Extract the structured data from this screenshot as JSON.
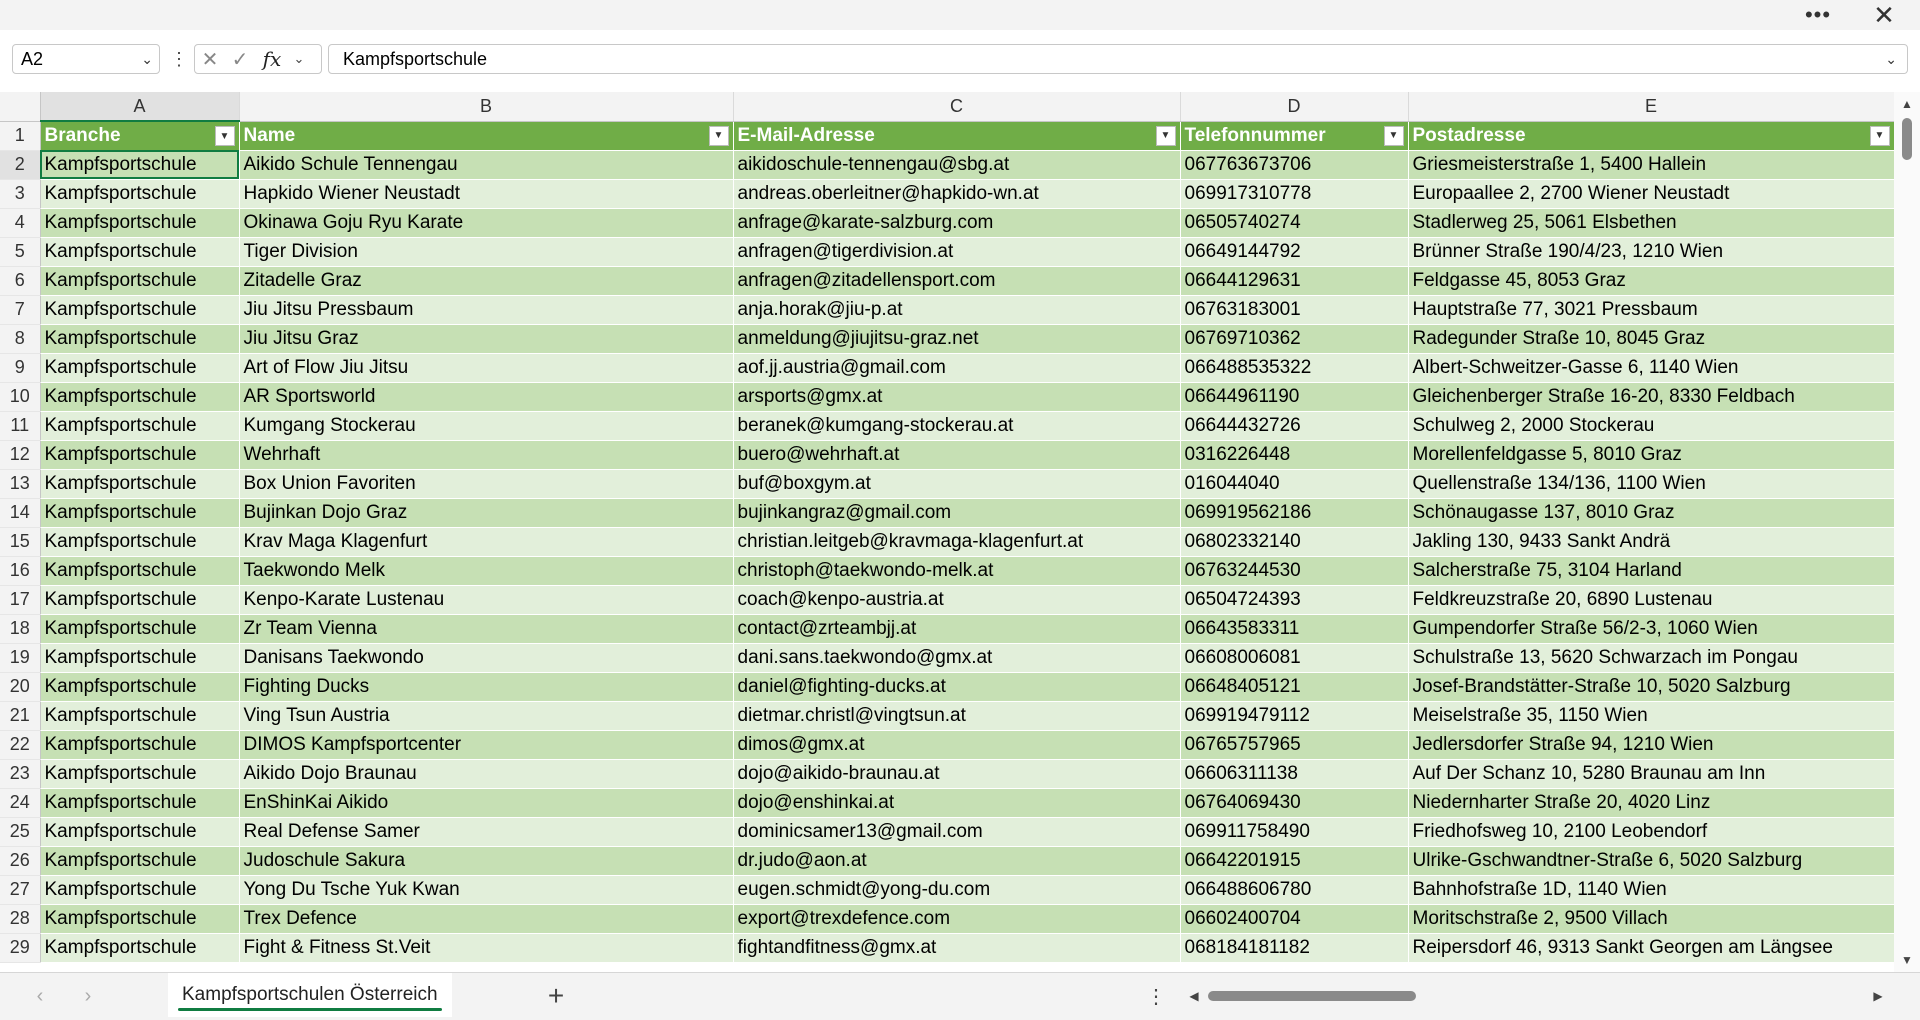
{
  "window": {
    "more_icon": "more-horizontal-icon",
    "close_icon": "close-icon"
  },
  "formula_bar": {
    "name_box": "A2",
    "formula": "Kampfsportschule",
    "fx_label": "fx"
  },
  "grid": {
    "columns": [
      "A",
      "B",
      "C",
      "D",
      "E"
    ],
    "selected_column": "A",
    "selected_row": 2,
    "header_row_number": 1,
    "headers": [
      "Branche",
      "Name",
      "E-Mail-Adresse",
      "Telefonnummer",
      "Postadresse"
    ],
    "rows": [
      {
        "n": 2,
        "cells": [
          "Kampfsportschule",
          "Aikido Schule Tennengau",
          "aikidoschule-tennengau@sbg.at",
          "067763673706",
          "Griesmeisterstraße 1, 5400 Hallein"
        ]
      },
      {
        "n": 3,
        "cells": [
          "Kampfsportschule",
          "Hapkido Wiener Neustadt",
          "andreas.oberleitner@hapkido-wn.at",
          "069917310778",
          "Europaallee 2, 2700 Wiener Neustadt"
        ]
      },
      {
        "n": 4,
        "cells": [
          "Kampfsportschule",
          "Okinawa Goju Ryu Karate",
          "anfrage@karate-salzburg.com",
          "06505740274",
          "Stadlerweg 25, 5061 Elsbethen"
        ]
      },
      {
        "n": 5,
        "cells": [
          "Kampfsportschule",
          "Tiger Division",
          "anfragen@tigerdivision.at",
          "06649144792",
          "Brünner Straße 190/4/23, 1210 Wien"
        ]
      },
      {
        "n": 6,
        "cells": [
          "Kampfsportschule",
          "Zitadelle Graz",
          "anfragen@zitadellensport.com",
          "06644129631",
          "Feldgasse 45, 8053 Graz"
        ]
      },
      {
        "n": 7,
        "cells": [
          "Kampfsportschule",
          "Jiu Jitsu Pressbaum",
          "anja.horak@jiu-p.at",
          "06763183001",
          "Hauptstraße 77, 3021 Pressbaum"
        ]
      },
      {
        "n": 8,
        "cells": [
          "Kampfsportschule",
          "Jiu Jitsu Graz",
          "anmeldung@jiujitsu-graz.net",
          "06769710362",
          "Radegunder Straße 10, 8045 Graz"
        ]
      },
      {
        "n": 9,
        "cells": [
          "Kampfsportschule",
          "Art of Flow Jiu Jitsu",
          "aof.jj.austria@gmail.com",
          "066488535322",
          "Albert-Schweitzer-Gasse 6, 1140 Wien"
        ]
      },
      {
        "n": 10,
        "cells": [
          "Kampfsportschule",
          "AR Sportsworld",
          "arsports@gmx.at",
          "06644961190",
          "Gleichenberger Straße 16-20, 8330 Feldbach"
        ]
      },
      {
        "n": 11,
        "cells": [
          "Kampfsportschule",
          "Kumgang Stockerau",
          "beranek@kumgang-stockerau.at",
          "06644432726",
          "Schulweg 2, 2000 Stockerau"
        ]
      },
      {
        "n": 12,
        "cells": [
          "Kampfsportschule",
          "Wehrhaft",
          "buero@wehrhaft.at",
          "0316226448",
          "Morellenfeldgasse 5, 8010 Graz"
        ]
      },
      {
        "n": 13,
        "cells": [
          "Kampfsportschule",
          "Box Union Favoriten",
          "buf@boxgym.at",
          "016044040",
          "Quellenstraße 134/136, 1100 Wien"
        ]
      },
      {
        "n": 14,
        "cells": [
          "Kampfsportschule",
          "Bujinkan Dojo Graz",
          "bujinkangraz@gmail.com",
          "069919562186",
          "Schönaugasse 137, 8010 Graz"
        ]
      },
      {
        "n": 15,
        "cells": [
          "Kampfsportschule",
          "Krav Maga Klagenfurt",
          "christian.leitgeb@kravmaga-klagenfurt.at",
          "06802332140",
          "Jakling 130, 9433 Sankt Andrä"
        ]
      },
      {
        "n": 16,
        "cells": [
          "Kampfsportschule",
          "Taekwondo Melk",
          "christoph@taekwondo-melk.at",
          "06763244530",
          "Salcherstraße 75, 3104 Harland"
        ]
      },
      {
        "n": 17,
        "cells": [
          "Kampfsportschule",
          "Kenpo-Karate Lustenau",
          "coach@kenpo-austria.at",
          "06504724393",
          "Feldkreuzstraße 20, 6890 Lustenau"
        ]
      },
      {
        "n": 18,
        "cells": [
          "Kampfsportschule",
          "Zr Team Vienna",
          "contact@zrteambjj.at",
          "06643583311",
          "Gumpendorfer Straße 56/2-3, 1060 Wien"
        ]
      },
      {
        "n": 19,
        "cells": [
          "Kampfsportschule",
          "Danisans Taekwondo",
          "dani.sans.taekwondo@gmx.at",
          "06608006081",
          "Schulstraße 13, 5620 Schwarzach im Pongau"
        ]
      },
      {
        "n": 20,
        "cells": [
          "Kampfsportschule",
          "Fighting Ducks",
          "daniel@fighting-ducks.at",
          "06648405121",
          "Josef-Brandstätter-Straße 10, 5020 Salzburg"
        ]
      },
      {
        "n": 21,
        "cells": [
          "Kampfsportschule",
          "Ving Tsun Austria",
          "dietmar.christl@vingtsun.at",
          "069919479112",
          "Meiselstraße 35, 1150 Wien"
        ]
      },
      {
        "n": 22,
        "cells": [
          "Kampfsportschule",
          "DIMOS Kampfsportcenter",
          "dimos@gmx.at",
          "06765757965",
          "Jedlersdorfer Straße 94, 1210 Wien"
        ]
      },
      {
        "n": 23,
        "cells": [
          "Kampfsportschule",
          "Aikido Dojo Braunau",
          "dojo@aikido-braunau.at",
          "06606311138",
          "Auf Der Schanz 10, 5280 Braunau am Inn"
        ]
      },
      {
        "n": 24,
        "cells": [
          "Kampfsportschule",
          "EnShinKai Aikido",
          "dojo@enshinkai.at",
          "06764069430",
          "Niedernharter Straße 20, 4020 Linz"
        ]
      },
      {
        "n": 25,
        "cells": [
          "Kampfsportschule",
          "Real Defense Samer",
          "dominicsamer13@gmail.com",
          "069911758490",
          "Friedhofsweg 10, 2100 Leobendorf"
        ]
      },
      {
        "n": 26,
        "cells": [
          "Kampfsportschule",
          "Judoschule Sakura",
          "dr.judo@aon.at",
          "06642201915",
          "Ulrike-Gschwandtner-Straße 6, 5020 Salzburg"
        ]
      },
      {
        "n": 27,
        "cells": [
          "Kampfsportschule",
          "Yong Du Tsche Yuk Kwan",
          "eugen.schmidt@yong-du.com",
          "066488606780",
          "Bahnhofstraße 1D, 1140 Wien"
        ]
      },
      {
        "n": 28,
        "cells": [
          "Kampfsportschule",
          "Trex Defence",
          "export@trexdefence.com",
          "06602400704",
          "Moritschstraße 2, 9500 Villach"
        ]
      },
      {
        "n": 29,
        "cells": [
          "Kampfsportschule",
          "Fight & Fitness St.Veit",
          "fightandfitness@gmx.at",
          "068184181182",
          "Reipersdorf 46, 9313 Sankt Georgen am Längsee"
        ]
      }
    ]
  },
  "sheet_tabs": {
    "active": "Kampfsportschulen Österreich",
    "add_label": "+"
  },
  "colors": {
    "header_green": "#70ad47",
    "band_dark": "#c6e0b4",
    "band_light": "#e2efda",
    "accent": "#107c41"
  }
}
